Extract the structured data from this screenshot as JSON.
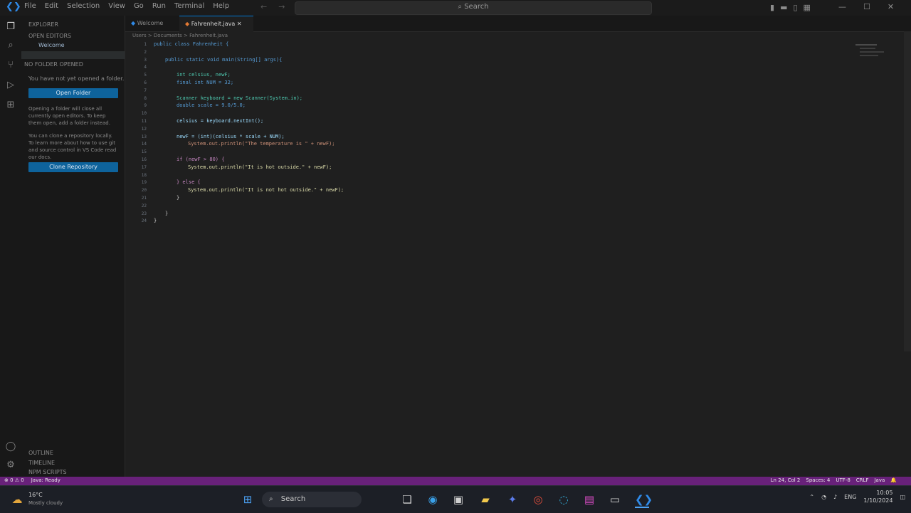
{
  "menu": [
    "File",
    "Edit",
    "Selection",
    "View",
    "Go",
    "Run",
    "Terminal",
    "Help"
  ],
  "search": {
    "label": "Search"
  },
  "sidebar": {
    "header": "EXPLORER",
    "section_open_editors": "OPEN EDITORS",
    "open_file": "Welcome",
    "section_folder": "NO FOLDER OPENED",
    "intro": "You have not yet opened a folder.",
    "open_folder_btn": "Open Folder",
    "para1": "Opening a folder will close all currently open editors. To keep them open, add a folder instead.",
    "para2": "You can clone a repository locally. To learn more about how to use git and source control in VS Code read our docs.",
    "clone_btn": "Clone Repository",
    "outline": "OUTLINE",
    "timeline": "TIMELINE",
    "more": "NPM SCRIPTS"
  },
  "tabs": [
    {
      "label": "Welcome"
    },
    {
      "label": "Fahrenheit.java"
    }
  ],
  "breadcrumb": "Users > Documents > Fahrenheit.java",
  "code_lines": [
    {
      "n": "1",
      "text": "public class Fahrenheit {",
      "color": "#569cd6",
      "indent": 0
    },
    {
      "n": "2",
      "text": "",
      "color": "#cccccc",
      "indent": 0
    },
    {
      "n": "3",
      "text": "public static void main(String[] args){",
      "color": "#569cd6",
      "indent": 1
    },
    {
      "n": "4",
      "text": "",
      "color": "#cccccc",
      "indent": 0
    },
    {
      "n": "5",
      "text": "int celsius, newF;",
      "color": "#4ec9b0",
      "indent": 2
    },
    {
      "n": "6",
      "text": "final int NUM = 32;",
      "color": "#569cd6",
      "indent": 2
    },
    {
      "n": "7",
      "text": "",
      "color": "#cccccc",
      "indent": 0
    },
    {
      "n": "8",
      "text": "Scanner keyboard = new Scanner(System.in);",
      "color": "#4ec9b0",
      "indent": 2
    },
    {
      "n": "9",
      "text": "double scale = 9.0/5.0;",
      "color": "#569cd6",
      "indent": 2
    },
    {
      "n": "10",
      "text": "",
      "color": "#cccccc",
      "indent": 0
    },
    {
      "n": "11",
      "text": "celsius = keyboard.nextInt();",
      "color": "#9cdcfe",
      "indent": 2
    },
    {
      "n": "12",
      "text": "",
      "color": "#cccccc",
      "indent": 0
    },
    {
      "n": "13",
      "text": "newF = (int)(celsius * scale + NUM);",
      "color": "#9cdcfe",
      "indent": 2
    },
    {
      "n": "14",
      "text": "System.out.println(\"The temperature is \" + newF);",
      "color": "#ce9178",
      "indent": 3
    },
    {
      "n": "15",
      "text": "",
      "color": "#cccccc",
      "indent": 0
    },
    {
      "n": "16",
      "text": "if (newF > 80) {",
      "color": "#c586c0",
      "indent": 2
    },
    {
      "n": "17",
      "text": "System.out.println(\"It is hot outside.\" + newF);",
      "color": "#dcdcaa",
      "indent": 3
    },
    {
      "n": "18",
      "text": "",
      "color": "#cccccc",
      "indent": 0
    },
    {
      "n": "19",
      "text": "} else {",
      "color": "#c586c0",
      "indent": 2
    },
    {
      "n": "20",
      "text": "System.out.println(\"It is not hot outside.\" + newF);",
      "color": "#dcdcaa",
      "indent": 3
    },
    {
      "n": "21",
      "text": "}",
      "color": "#cccccc",
      "indent": 2
    },
    {
      "n": "22",
      "text": "",
      "color": "#cccccc",
      "indent": 0
    },
    {
      "n": "23",
      "text": "}",
      "color": "#cccccc",
      "indent": 1
    },
    {
      "n": "24",
      "text": "}",
      "color": "#cccccc",
      "indent": 0
    }
  ],
  "statusbar": {
    "left": [
      "⊗ 0 ⚠ 0",
      "Java: Ready"
    ],
    "right": [
      "Ln 24, Col 2",
      "Spaces: 4",
      "UTF-8",
      "CRLF",
      "Java"
    ]
  },
  "taskbar": {
    "weather": "16°C",
    "weather_sub": "Mostly cloudy",
    "search": "Search",
    "time": "10:05",
    "date": "1/10/2024",
    "lang": "ENG"
  },
  "colors": {
    "accent": "#0e639c",
    "status": "#68217a"
  }
}
